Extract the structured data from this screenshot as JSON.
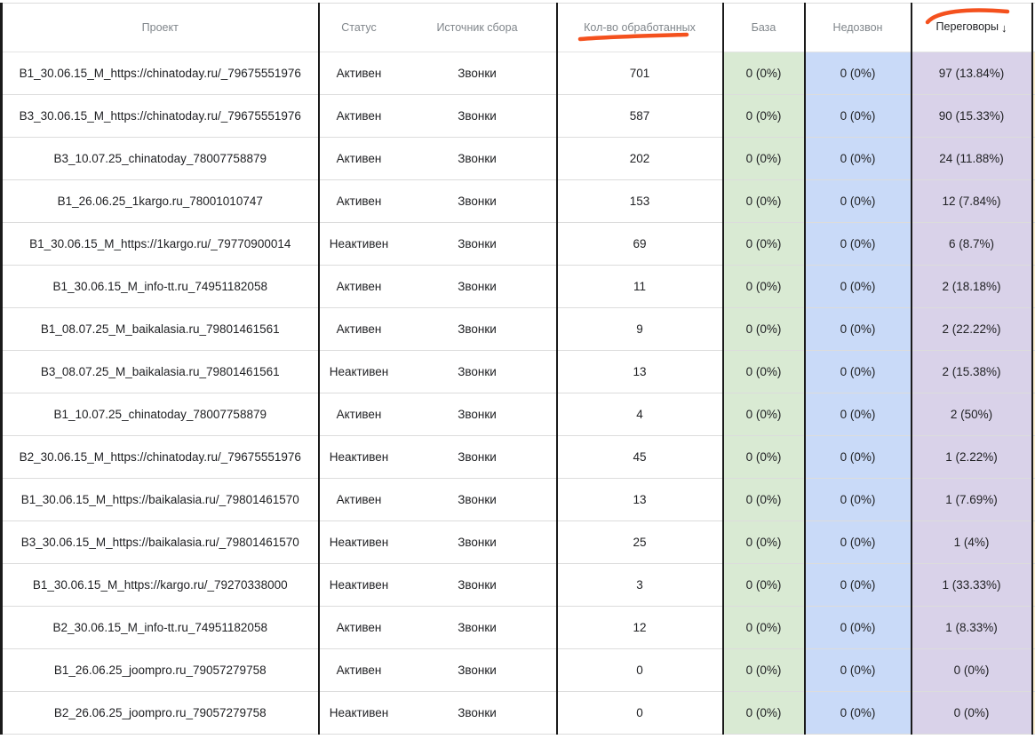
{
  "headers": {
    "project": "Проект",
    "status": "Статус",
    "source": "Источник сбора",
    "processed": "Кол-во обработанных",
    "base": "База",
    "no_answer": "Недозвон",
    "negotiations": "Переговоры",
    "sort_arrow": "↓"
  },
  "colors": {
    "base_column": "#d9ead3",
    "no_answer_column": "#c9daf8",
    "negotiations_column": "#d9d2e9",
    "highlight_marker": "#f4511e"
  },
  "rows": [
    {
      "project": "B1_30.06.15_M_https://chinatoday.ru/_79675551976",
      "status": "Активен",
      "source": "Звонки",
      "processed": "701",
      "base": "0 (0%)",
      "no_answer": "0 (0%)",
      "negotiations": "97 (13.84%)"
    },
    {
      "project": "B3_30.06.15_M_https://chinatoday.ru/_79675551976",
      "status": "Активен",
      "source": "Звонки",
      "processed": "587",
      "base": "0 (0%)",
      "no_answer": "0 (0%)",
      "negotiations": "90 (15.33%)"
    },
    {
      "project": "B3_10.07.25_chinatoday_78007758879",
      "status": "Активен",
      "source": "Звонки",
      "processed": "202",
      "base": "0 (0%)",
      "no_answer": "0 (0%)",
      "negotiations": "24 (11.88%)"
    },
    {
      "project": "B1_26.06.25_1kargo.ru_78001010747",
      "status": "Активен",
      "source": "Звонки",
      "processed": "153",
      "base": "0 (0%)",
      "no_answer": "0 (0%)",
      "negotiations": "12 (7.84%)"
    },
    {
      "project": "B1_30.06.15_M_https://1kargo.ru/_79770900014",
      "status": "Неактивен",
      "source": "Звонки",
      "processed": "69",
      "base": "0 (0%)",
      "no_answer": "0 (0%)",
      "negotiations": "6 (8.7%)"
    },
    {
      "project": "B1_30.06.15_M_info-tt.ru_74951182058",
      "status": "Активен",
      "source": "Звонки",
      "processed": "11",
      "base": "0 (0%)",
      "no_answer": "0 (0%)",
      "negotiations": "2 (18.18%)"
    },
    {
      "project": "B1_08.07.25_M_baikalasia.ru_79801461561",
      "status": "Активен",
      "source": "Звонки",
      "processed": "9",
      "base": "0 (0%)",
      "no_answer": "0 (0%)",
      "negotiations": "2 (22.22%)"
    },
    {
      "project": "B3_08.07.25_M_baikalasia.ru_79801461561",
      "status": "Неактивен",
      "source": "Звонки",
      "processed": "13",
      "base": "0 (0%)",
      "no_answer": "0 (0%)",
      "negotiations": "2 (15.38%)"
    },
    {
      "project": "B1_10.07.25_chinatoday_78007758879",
      "status": "Активен",
      "source": "Звонки",
      "processed": "4",
      "base": "0 (0%)",
      "no_answer": "0 (0%)",
      "negotiations": "2 (50%)"
    },
    {
      "project": "B2_30.06.15_M_https://chinatoday.ru/_79675551976",
      "status": "Неактивен",
      "source": "Звонки",
      "processed": "45",
      "base": "0 (0%)",
      "no_answer": "0 (0%)",
      "negotiations": "1 (2.22%)"
    },
    {
      "project": "B1_30.06.15_M_https://baikalasia.ru/_79801461570",
      "status": "Активен",
      "source": "Звонки",
      "processed": "13",
      "base": "0 (0%)",
      "no_answer": "0 (0%)",
      "negotiations": "1 (7.69%)"
    },
    {
      "project": "B3_30.06.15_M_https://baikalasia.ru/_79801461570",
      "status": "Неактивен",
      "source": "Звонки",
      "processed": "25",
      "base": "0 (0%)",
      "no_answer": "0 (0%)",
      "negotiations": "1 (4%)"
    },
    {
      "project": "B1_30.06.15_M_https://kargo.ru/_79270338000",
      "status": "Неактивен",
      "source": "Звонки",
      "processed": "3",
      "base": "0 (0%)",
      "no_answer": "0 (0%)",
      "negotiations": "1 (33.33%)"
    },
    {
      "project": "B2_30.06.15_M_info-tt.ru_74951182058",
      "status": "Активен",
      "source": "Звонки",
      "processed": "12",
      "base": "0 (0%)",
      "no_answer": "0 (0%)",
      "negotiations": "1 (8.33%)"
    },
    {
      "project": "B1_26.06.25_joompro.ru_79057279758",
      "status": "Активен",
      "source": "Звонки",
      "processed": "0",
      "base": "0 (0%)",
      "no_answer": "0 (0%)",
      "negotiations": "0 (0%)"
    },
    {
      "project": "B2_26.06.25_joompro.ru_79057279758",
      "status": "Неактивен",
      "source": "Звонки",
      "processed": "0",
      "base": "0 (0%)",
      "no_answer": "0 (0%)",
      "negotiations": "0 (0%)"
    }
  ]
}
